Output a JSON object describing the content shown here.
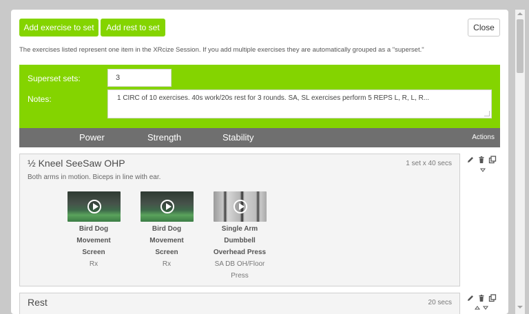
{
  "toolbar": {
    "add_exercise_label": "Add exercise to set",
    "add_rest_label": "Add rest to set",
    "close_label": "Close"
  },
  "info_text": "The exercises listed represent one item in the XRcize Session. If you add multiple exercises they are automatically grouped as a \"superset.\"",
  "superset": {
    "sets_label": "Superset sets:",
    "sets_value": "3",
    "notes_label": "Notes:",
    "notes_value": "1 CIRC of 10 exercises. 40s work/20s rest for 3 rounds. SA, SL exercises perform 5 REPS L, R, L, R..."
  },
  "tabs": [
    "Power",
    "Strength",
    "Stability"
  ],
  "actions_header": "Actions",
  "items": [
    {
      "title": "½ Kneel SeeSaw OHP",
      "meta": "1 set x 40 secs",
      "description": "Both arms in motion. Biceps in line with ear.",
      "exercises": [
        {
          "name_lines": [
            "Bird Dog",
            "Movement",
            "Screen"
          ],
          "sub_lines": [
            "Rx"
          ],
          "thumb": "gym"
        },
        {
          "name_lines": [
            "Bird Dog",
            "Movement",
            "Screen"
          ],
          "sub_lines": [
            "Rx"
          ],
          "thumb": "gym"
        },
        {
          "name_lines": [
            "Single Arm",
            "Dumbbell",
            "Overhead Press"
          ],
          "sub_lines": [
            "SA DB OH/Floor",
            "Press"
          ],
          "thumb": "rack"
        }
      ]
    },
    {
      "title": "Rest",
      "meta": "20 secs"
    }
  ],
  "icons": {
    "edit": "pencil-icon",
    "delete": "trash-icon",
    "copy": "copy-icon",
    "play": "play-icon",
    "move_down": "caret-down-icon",
    "move_up": "caret-up-icon"
  },
  "colors": {
    "accent_green": "#84d400",
    "tab_bar": "#6f6f6f",
    "card_bg": "#f4f4f4"
  }
}
